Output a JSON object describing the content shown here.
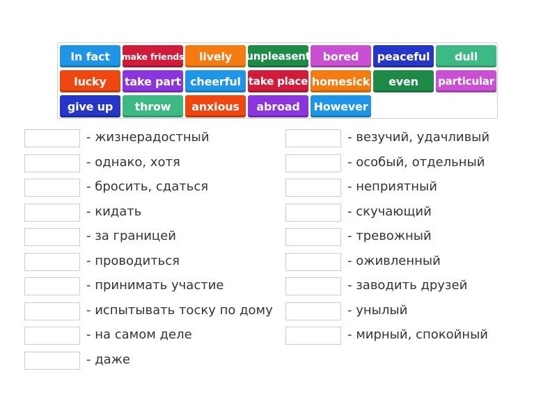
{
  "tiles": [
    {
      "label": "In fact",
      "color": "#1e95e6"
    },
    {
      "label": "make friends",
      "color": "#d01c3a"
    },
    {
      "label": "lively",
      "color": "#f57a10"
    },
    {
      "label": "unpleasent",
      "color": "#1e8a48"
    },
    {
      "label": "bored",
      "color": "#c94fd3"
    },
    {
      "label": "peaceful",
      "color": "#2536c8"
    },
    {
      "label": "dull",
      "color": "#3dba84"
    },
    {
      "label": "lucky",
      "color": "#f0460f"
    },
    {
      "label": "take part",
      "color": "#8a35de"
    },
    {
      "label": "cheerful",
      "color": "#1e95e6"
    },
    {
      "label": "take place",
      "color": "#d01c3a"
    },
    {
      "label": "homesick",
      "color": "#f57a10"
    },
    {
      "label": "even",
      "color": "#1e8a48"
    },
    {
      "label": "particular",
      "color": "#c94fd3"
    },
    {
      "label": "give up",
      "color": "#2536c8"
    },
    {
      "label": "throw",
      "color": "#3dba84"
    },
    {
      "label": "anxious",
      "color": "#f0460f"
    },
    {
      "label": "abroad",
      "color": "#8a35de"
    },
    {
      "label": "However",
      "color": "#1e95e6"
    }
  ],
  "left_items": [
    {
      "slot_value": "",
      "definition": "- жизнерадостный"
    },
    {
      "slot_value": "",
      "definition": "- однако, хотя"
    },
    {
      "slot_value": "",
      "definition": "- бросить, сдаться"
    },
    {
      "slot_value": "",
      "definition": "- кидать"
    },
    {
      "slot_value": "",
      "definition": "- за границей"
    },
    {
      "slot_value": "",
      "definition": "- проводиться"
    },
    {
      "slot_value": "",
      "definition": "- принимать участие"
    },
    {
      "slot_value": "",
      "definition": "- испытывать тоску по дому"
    },
    {
      "slot_value": "",
      "definition": "- на самом деле"
    },
    {
      "slot_value": "",
      "definition": "- даже"
    }
  ],
  "right_items": [
    {
      "slot_value": "",
      "definition": "- везучий, удачливый"
    },
    {
      "slot_value": "",
      "definition": "- особый, отдельный"
    },
    {
      "slot_value": "",
      "definition": "- неприятный"
    },
    {
      "slot_value": "",
      "definition": "- скучающий"
    },
    {
      "slot_value": "",
      "definition": "- тревожный"
    },
    {
      "slot_value": "",
      "definition": "- оживленный"
    },
    {
      "slot_value": "",
      "definition": "- заводить друзей"
    },
    {
      "slot_value": "",
      "definition": "- унылый"
    },
    {
      "slot_value": "",
      "definition": "- мирный, спокойный"
    }
  ]
}
